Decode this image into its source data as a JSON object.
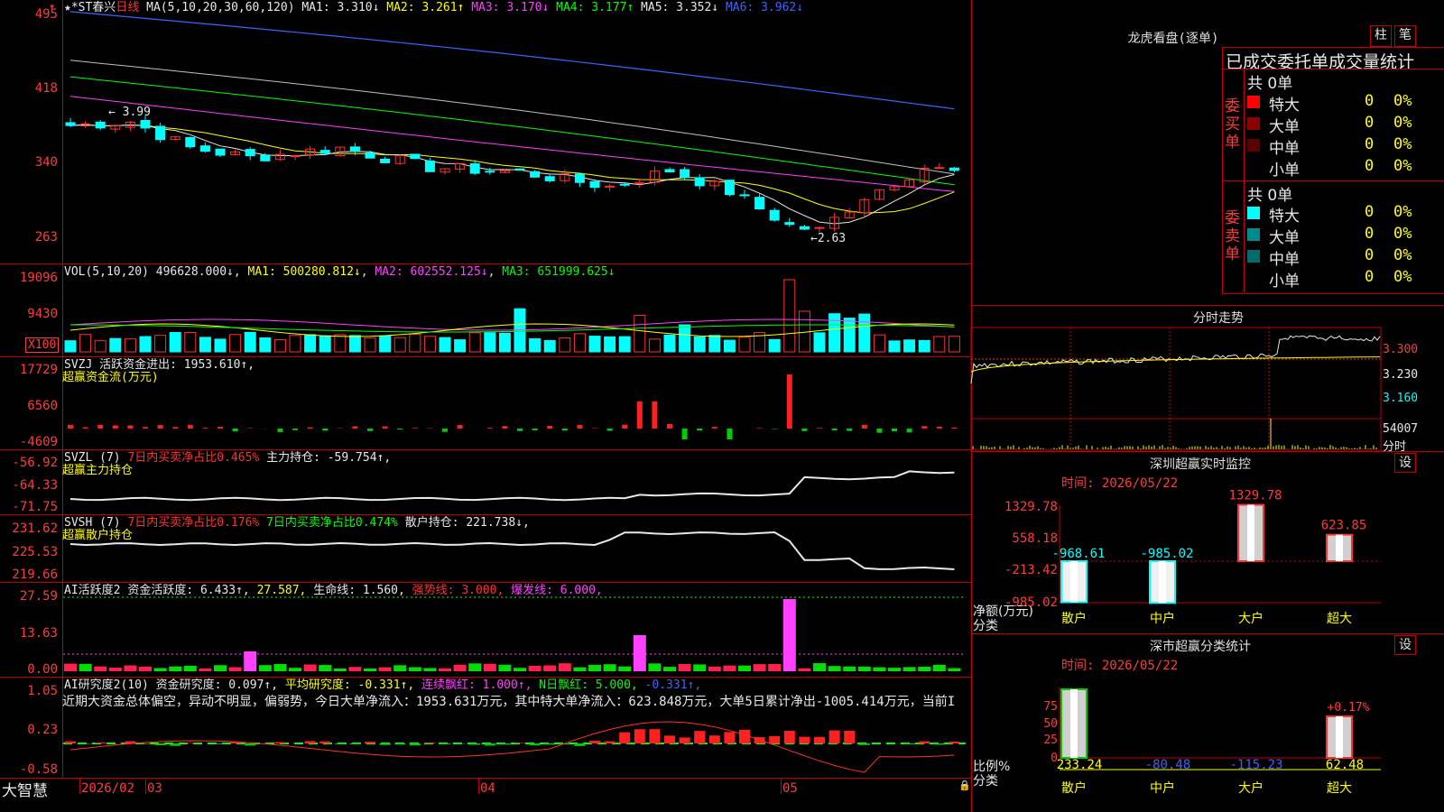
{
  "app": {
    "brand": "大智慧"
  },
  "kline": {
    "title": "★*ST春兴",
    "period": "日线",
    "ma_label": "MA(5,10,20,30,60,120)",
    "ma": [
      {
        "label": "MA1:",
        "value": "3.310↓",
        "color": "#e8e8e8"
      },
      {
        "label": "MA2:",
        "value": "3.261↑",
        "color": "#ffff00"
      },
      {
        "label": "MA3:",
        "value": "3.170↓",
        "color": "#ff40ff"
      },
      {
        "label": "MA4:",
        "value": "3.177↑",
        "color": "#00ff00"
      },
      {
        "label": "MA5:",
        "value": "3.352↓",
        "color": "#e8e8e8"
      },
      {
        "label": "MA6:",
        "value": "3.962↓",
        "color": "#3c64ff"
      }
    ],
    "yticks": [
      "495",
      "418",
      "340",
      "263"
    ],
    "high_marker": "3.99",
    "low_marker": "2.63"
  },
  "vol": {
    "label": "VOL(5,10,20)",
    "value": "496628.000↓",
    "ma1": "MA1: 500280.812↓",
    "ma2": "MA2: 602552.125↓",
    "ma3": "MA3: 651999.625↓",
    "yticks": [
      "19096",
      "9430"
    ],
    "unit": "X100"
  },
  "svzj": {
    "label": "SVZJ",
    "line1": "活跃资金进出: 1953.610↑,",
    "line2": "超赢资金流(万元)",
    "yticks": [
      "17729",
      "6560",
      "-4609"
    ]
  },
  "svzl": {
    "label": "SVZL (7)",
    "red": "7日内买卖净占比0.465%",
    "white": "主力持仓: -59.754↑,",
    "line2": "超赢主力持仓",
    "yticks": [
      "-56.92",
      "-64.33",
      "-71.75"
    ]
  },
  "svsh": {
    "label": "SVSH (7)",
    "red": "7日内买卖净占比0.176%",
    "green": "7日内买卖净占比0.474%",
    "white": "散户持仓: 221.738↓,",
    "line2": "超赢散户持仓",
    "yticks": [
      "231.62",
      "225.53",
      "219.66"
    ]
  },
  "ai1": {
    "label": "AI活跃度2",
    "a": "资金活跃度: 6.433↑,",
    "b": "27.587,",
    "c": "生命线: 1.560,",
    "d": "强势线: 3.000,",
    "e": "爆发线: 6.000,",
    "yticks": [
      "27.59",
      "13.63",
      "0.00"
    ]
  },
  "ai2": {
    "label": "AI研究度2(10)",
    "a": "资金研究度: 0.097↑,",
    "b": "平均研究度: -0.331↑,",
    "c": "连续飘红: 1.000↑,",
    "d": "N日飘红: 5.000,",
    "e": "-0.331↑,",
    "comment": "近期大资金总体偏空，异动不明显，偏弱势，今日大单净流入：1953.631万元，其中特大单净流入：623.848万元，大单5日累计净出-1005.414万元，当前I",
    "yticks": [
      "1.05",
      "0.23",
      "-0.58"
    ]
  },
  "xaxis": [
    "2026/02",
    "03",
    "04",
    "05"
  ],
  "lhb": {
    "title": "龙虎看盘(逐单)",
    "tabs": [
      "柱",
      "笔"
    ],
    "subtitle": "已成交委托单成交量统计",
    "buy_label": "委买单",
    "sell_label": "委卖单",
    "buy_total": "共 0单",
    "sell_total": "共 0单",
    "buy_rows": [
      {
        "name": "特大",
        "count": "0",
        "pct": "0%",
        "color": "#ff0000"
      },
      {
        "name": "大单",
        "count": "0",
        "pct": "0%",
        "color": "#8b0000"
      },
      {
        "name": "中单",
        "count": "0",
        "pct": "0%",
        "color": "#5a0000"
      },
      {
        "name": "小单",
        "count": "0",
        "pct": "0%",
        "color": ""
      }
    ],
    "sell_rows": [
      {
        "name": "特大",
        "count": "0",
        "pct": "0%",
        "color": "#00ffff"
      },
      {
        "name": "大单",
        "count": "0",
        "pct": "0%",
        "color": "#008b8b"
      },
      {
        "name": "中单",
        "count": "0",
        "pct": "0%",
        "color": "#006b6b"
      },
      {
        "name": "小单",
        "count": "0",
        "pct": "0%",
        "color": ""
      }
    ]
  },
  "intraday": {
    "title": "分时走势",
    "yticks": [
      "3.300",
      "3.230",
      "3.160"
    ],
    "vol_label": "54007",
    "vol_unit": "分时"
  },
  "monitor": {
    "title": "深圳超赢实时监控",
    "set": "设",
    "time": "时间: 2026/05/22",
    "yticks": [
      "1329.78",
      "558.18",
      "-213.42",
      "-985.02"
    ],
    "ylabel_a": "净额(万元)",
    "ylabel_b": "分类",
    "bars": [
      {
        "cat": "散户",
        "value": -968.61,
        "label": "-968.61"
      },
      {
        "cat": "中户",
        "value": -985.02,
        "label": "-985.02"
      },
      {
        "cat": "大户",
        "value": 1329.78,
        "label": "1329.78"
      },
      {
        "cat": "超大",
        "value": 623.85,
        "label": "623.85"
      }
    ]
  },
  "classify": {
    "title": "深市超赢分类统计",
    "set": "设",
    "time": "时间: 2026/05/22",
    "yticks": [
      "75",
      "50",
      "25",
      "0"
    ],
    "ylabel_a": "比例%",
    "ylabel_b": "分类",
    "pct_label": "+0.17%",
    "bars": [
      {
        "cat": "散户",
        "value": 233.24,
        "label": "233.24"
      },
      {
        "cat": "中户",
        "value": -80.48,
        "label": "-80.48"
      },
      {
        "cat": "大户",
        "value": -115.23,
        "label": "-115.23"
      },
      {
        "cat": "超大",
        "value": 62.48,
        "label": "62.48"
      }
    ]
  }
}
